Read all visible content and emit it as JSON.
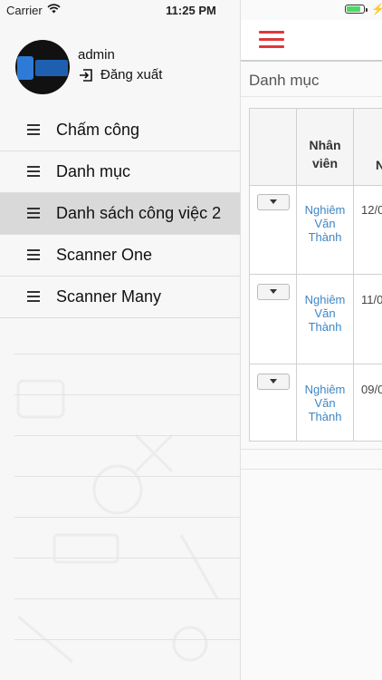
{
  "status_bar": {
    "carrier": "Carrier",
    "time": "11:25 PM",
    "battery_level": 0.85
  },
  "profile": {
    "username": "admin",
    "logout_label": "Đăng xuất"
  },
  "menu": {
    "items": [
      {
        "label": "Chấm công",
        "active": false
      },
      {
        "label": "Danh mục",
        "active": false
      },
      {
        "label": "Danh sách công việc 2",
        "active": true
      },
      {
        "label": "Scanner One",
        "active": false
      },
      {
        "label": "Scanner Many",
        "active": false
      }
    ]
  },
  "main": {
    "breadcrumb": "Danh mục",
    "table": {
      "headers": {
        "employee": "Nhân viên",
        "next": "N"
      },
      "rows": [
        {
          "employee": "Nghiêm Văn Thành",
          "date": "12/0"
        },
        {
          "employee": "Nghiêm Văn Thành",
          "date": "11/0"
        },
        {
          "employee": "Nghiêm Văn Thành",
          "date": "09/0"
        }
      ]
    }
  },
  "colors": {
    "accent": "#e0363a",
    "link": "#3d86c6",
    "active_bg": "#d9d9d9"
  }
}
